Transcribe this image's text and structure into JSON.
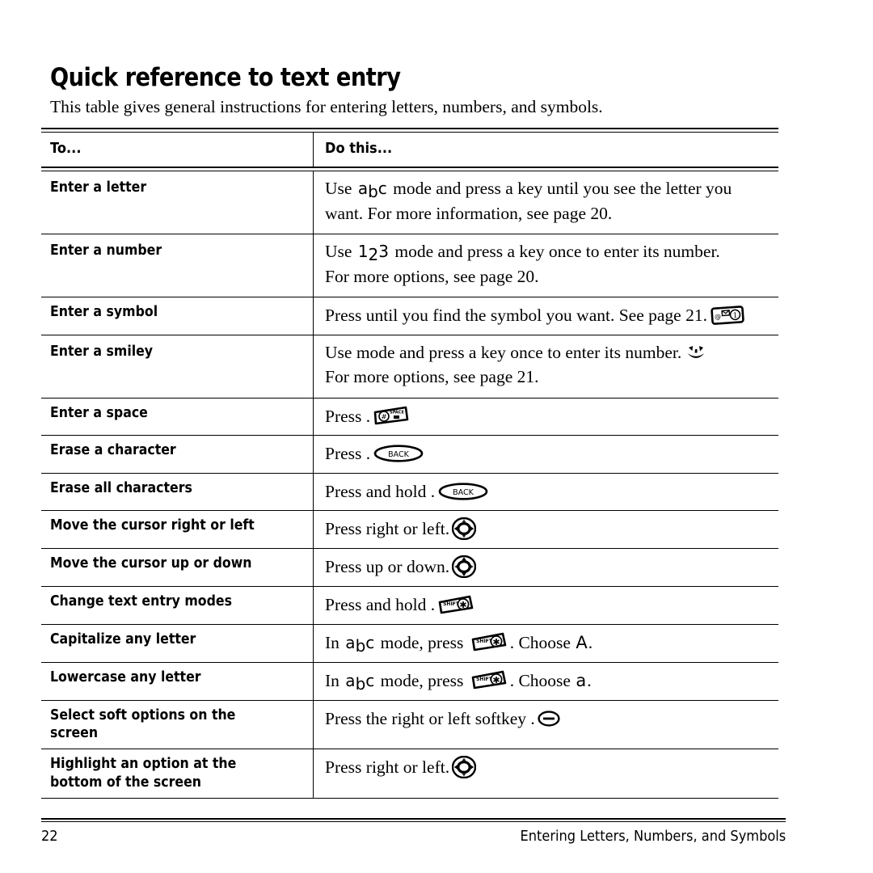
{
  "document": {
    "title": "Quick reference to text entry",
    "intro": "This table gives general instructions for entering letters, numbers, and symbols."
  },
  "table": {
    "header": {
      "col1": "To...",
      "col2": "Do this..."
    },
    "rows": [
      {
        "label": "Enter a letter",
        "lines": [
          {
            "pre": "Use ",
            "mode": "abc",
            "post": " mode and press a key until you see the letter you"
          },
          {
            "pre": "want. For more information, see page 20."
          }
        ]
      },
      {
        "label": "Enter a number",
        "lines": [
          {
            "pre": "Use ",
            "mode": "123",
            "post": " mode and press a key once to enter its number."
          },
          {
            "pre": "For more options, see page 20."
          }
        ]
      },
      {
        "label": "Enter a symbol",
        "lines": [
          {
            "pre": "Press ",
            "icon": "symbol-key-icon",
            "post": " until you find the symbol you want. See page 21."
          }
        ]
      },
      {
        "label": "Enter a smiley",
        "lines": [
          {
            "pre": "Use ",
            "icon": "smiley-icon",
            "post": " mode and press a key once to enter its number."
          },
          {
            "pre": "For more options, see page 21."
          }
        ]
      },
      {
        "label": "Enter a space",
        "lines": [
          {
            "pre": "Press ",
            "icon": "space-key-icon",
            "post": " ."
          }
        ]
      },
      {
        "label": "Erase a character",
        "lines": [
          {
            "pre": "Press ",
            "icon": "back-key-icon",
            "post": " ."
          }
        ]
      },
      {
        "label": "Erase all characters",
        "lines": [
          {
            "pre": "Press and hold ",
            "icon": "back-key-icon",
            "post": " ."
          }
        ]
      },
      {
        "label": "Move the cursor right or left",
        "lines": [
          {
            "pre": "Press ",
            "icon": "nav-key-leftright-icon",
            "post": " right or left."
          }
        ]
      },
      {
        "label": "Move the cursor up or down",
        "lines": [
          {
            "pre": "Press ",
            "icon": "nav-key-updown-icon",
            "post": " up or down."
          }
        ]
      },
      {
        "label": "Change text entry modes",
        "lines": [
          {
            "pre": "Press and hold ",
            "icon": "shift-key-icon",
            "post": " ."
          }
        ]
      },
      {
        "label": "Capitalize any letter",
        "lines": [
          {
            "pre": "In ",
            "mode": "abc",
            "post": " mode, press ",
            "icon": "shift-key-icon",
            "post2": ". Choose ",
            "choose": "A",
            "post3": "."
          }
        ]
      },
      {
        "label": "Lowercase any letter",
        "lines": [
          {
            "pre": "In ",
            "mode": "abc",
            "post": " mode, press ",
            "icon": "shift-key-icon",
            "post2": ". Choose ",
            "choose": "a",
            "post3": "."
          }
        ]
      },
      {
        "label": "Select soft options on the screen",
        "lines": [
          {
            "pre": "Press the right or left softkey ",
            "icon": "softkey-icon",
            "post": " ."
          }
        ]
      },
      {
        "label": "Highlight an option at the bottom of the screen",
        "lines": [
          {
            "pre": "Press ",
            "icon": "nav-key-leftright-icon",
            "post": " right or left."
          }
        ]
      }
    ]
  },
  "footer": {
    "page_number": "22",
    "section": "Entering Letters, Numbers, and Symbols"
  },
  "colors": {
    "text": "#000000",
    "background": "#ffffff",
    "rule": "#000000"
  }
}
